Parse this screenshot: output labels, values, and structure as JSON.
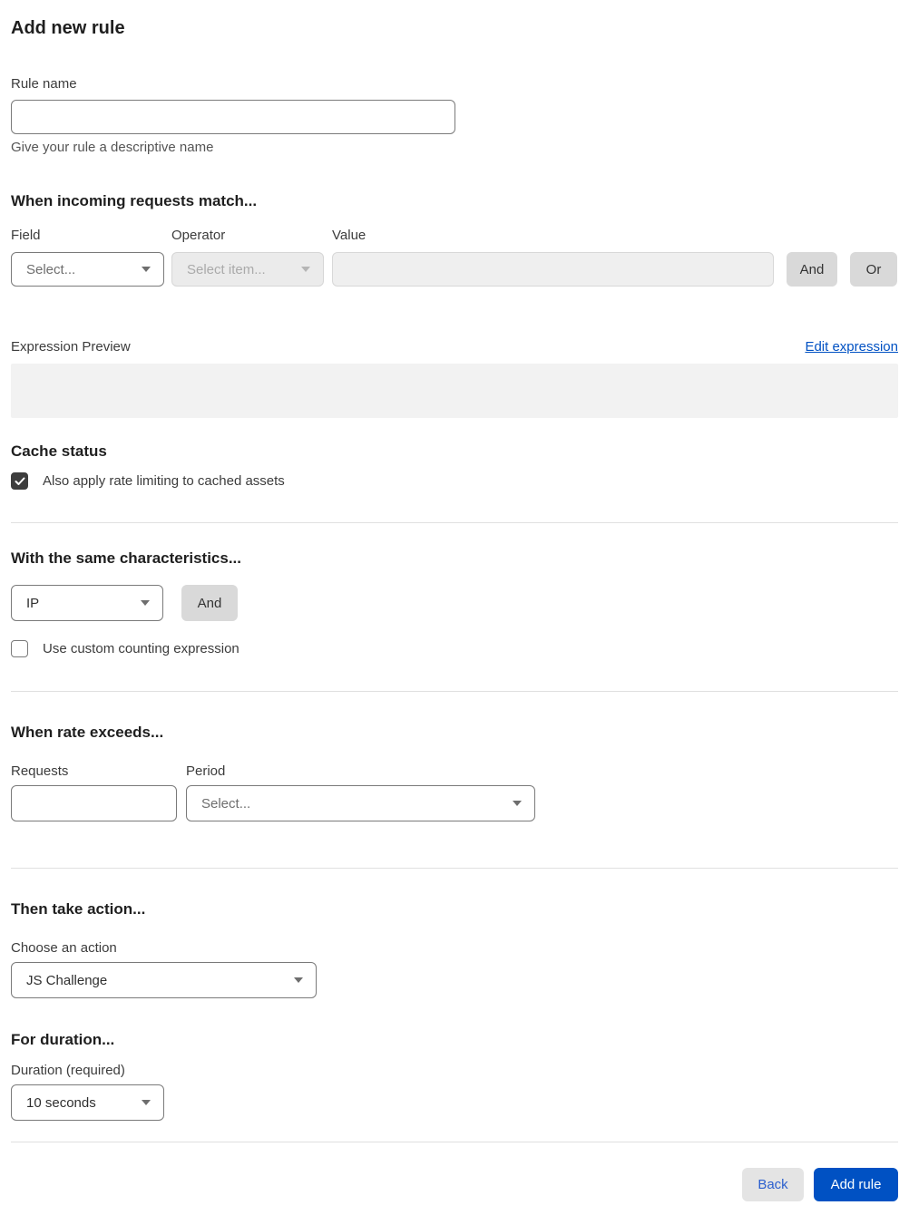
{
  "page": {
    "title": "Add new rule"
  },
  "rule_name": {
    "label": "Rule name",
    "value": "",
    "helper": "Give your rule a descriptive name"
  },
  "match_section": {
    "title": "When incoming requests match...",
    "field": {
      "label": "Field",
      "selected": "Select..."
    },
    "operator": {
      "label": "Operator",
      "selected": "Select item...",
      "disabled": true
    },
    "value": {
      "label": "Value",
      "value": "",
      "disabled": true
    },
    "and_button": "And",
    "or_button": "Or",
    "expression_preview_label": "Expression Preview",
    "edit_expression_link": "Edit expression",
    "expression_preview_value": ""
  },
  "cache_status": {
    "title": "Cache status",
    "checkbox_label": "Also apply rate limiting to cached assets",
    "checked": true
  },
  "characteristics": {
    "title": "With the same characteristics...",
    "selected": "IP",
    "and_button": "And",
    "checkbox_label": "Use custom counting expression",
    "checked": false
  },
  "rate_section": {
    "title": "When rate exceeds...",
    "requests": {
      "label": "Requests",
      "value": ""
    },
    "period": {
      "label": "Period",
      "selected": "Select..."
    }
  },
  "action_section": {
    "title": "Then take action...",
    "label": "Choose an action",
    "selected": "JS Challenge"
  },
  "duration_section": {
    "title": "For duration...",
    "label": "Duration (required)",
    "selected": "10 seconds"
  },
  "footer": {
    "back_button": "Back",
    "add_rule_button": "Add rule"
  },
  "colors": {
    "accent_blue": "#0051c3",
    "checkbox_checked": "#3d3d3d",
    "disabled_bg": "#ebebeb",
    "preview_bg": "#f2f2f2"
  }
}
